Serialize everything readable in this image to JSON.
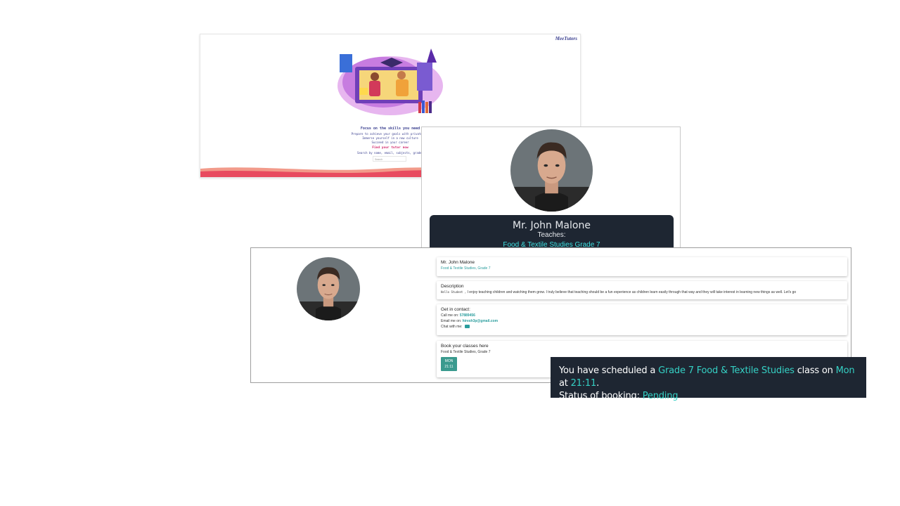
{
  "landing": {
    "logo": "MeeTutors",
    "tagline": "Focus on the skills you need",
    "lines": [
      "Prepare to achieve your goals with private tut",
      "Immerse yourself in a new culture",
      "Succeed in your career"
    ],
    "find_title": "Find your tutor now",
    "find_sub": "Search by name, email, subjects, grades",
    "search_placeholder": "Search"
  },
  "profile_card": {
    "name": "Mr. John Malone",
    "teaches_label": "Teaches:",
    "subject": "Food & Textile Studies Grade 7"
  },
  "profile_detail": {
    "name": "Mr. John Malone",
    "subject_line": "Food & Textile Studies, Grade 7",
    "description_title": "Description",
    "description_greeting": "Hello Student ,",
    "description_text": "I enjoy teaching children and watching them grow. I truly believe that teaching should be a fun experience as children learn easily through that way and they will take interest in learning new things as well. Let's go",
    "contact_title": "Get in contact:",
    "call_label": "Call me on:",
    "call_value": "57889456",
    "email_label": "Email me on:",
    "email_value": "hiresh3p@gmail.com",
    "chat_label": "Chat with me:",
    "book_title": "Book your classes here",
    "book_subject": "Food & Textile Studies, Grade 7",
    "slot_day": "MON",
    "slot_time": "21:11"
  },
  "toast": {
    "part1": "You have scheduled a",
    "class_name": "Grade 7 Food & Textile Studies",
    "part2": "class on",
    "day": "Mon",
    "part3": "at",
    "time": "21:11",
    "part4": ".",
    "status_label": "Status of booking:",
    "status_value": "Pending"
  },
  "colors": {
    "accent": "#35d0c4",
    "teal": "#2a9d9d",
    "dark_panel": "#1e2632"
  }
}
